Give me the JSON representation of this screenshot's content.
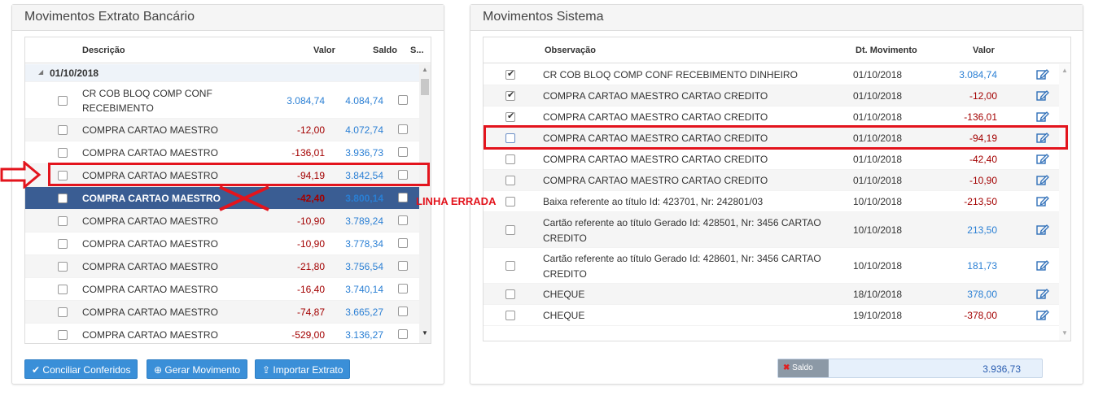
{
  "left_panel": {
    "title": "Movimentos Extrato Bancário",
    "columns": {
      "descricao": "Descrição",
      "valor": "Valor",
      "saldo": "Saldo",
      "s": "S..."
    },
    "group_label": "01/10/2018",
    "rows": [
      {
        "desc1": "CR COB BLOQ COMP CONF",
        "desc2": "RECEBIMENTO",
        "valor": "3.084,74",
        "saldo": "4.084,74"
      },
      {
        "desc1": "COMPRA CARTAO MAESTRO",
        "valor": "-12,00",
        "saldo": "4.072,74"
      },
      {
        "desc1": "COMPRA CARTAO MAESTRO",
        "valor": "-136,01",
        "saldo": "3.936,73"
      },
      {
        "desc1": "COMPRA CARTAO MAESTRO",
        "valor": "-94,19",
        "saldo": "3.842,54"
      },
      {
        "desc1": "COMPRA CARTAO MAESTRO",
        "valor": "-42,40",
        "saldo": "3.800,14"
      },
      {
        "desc1": "COMPRA CARTAO MAESTRO",
        "valor": "-10,90",
        "saldo": "3.789,24"
      },
      {
        "desc1": "COMPRA CARTAO MAESTRO",
        "valor": "-10,90",
        "saldo": "3.778,34"
      },
      {
        "desc1": "COMPRA CARTAO MAESTRO",
        "valor": "-21,80",
        "saldo": "3.756,54"
      },
      {
        "desc1": "COMPRA CARTAO MAESTRO",
        "valor": "-16,40",
        "saldo": "3.740,14"
      },
      {
        "desc1": "COMPRA CARTAO MAESTRO",
        "valor": "-74,87",
        "saldo": "3.665,27"
      },
      {
        "desc1": "COMPRA CARTAO MAESTRO",
        "valor": "-529,00",
        "saldo": "3.136,27"
      }
    ],
    "buttons": {
      "conciliar": "Conciliar Conferidos",
      "gerar": "Gerar Movimento",
      "importar": "Importar Extrato"
    }
  },
  "annotation": {
    "wrong_line": "LINHA ERRADA",
    "color": "#e3141d"
  },
  "right_panel": {
    "title": "Movimentos Sistema",
    "columns": {
      "observacao": "Observação",
      "dt_movimento": "Dt. Movimento",
      "valor": "Valor"
    },
    "rows": [
      {
        "obs1": "CR COB BLOQ COMP CONF RECEBIMENTO DINHEIRO",
        "dt": "01/10/2018",
        "valor": "3.084,74"
      },
      {
        "obs1": "COMPRA CARTAO MAESTRO CARTAO CREDITO",
        "dt": "01/10/2018",
        "valor": "-12,00"
      },
      {
        "obs1": "COMPRA CARTAO MAESTRO CARTAO CREDITO",
        "dt": "01/10/2018",
        "valor": "-136,01"
      },
      {
        "obs1": "COMPRA CARTAO MAESTRO CARTAO CREDITO",
        "dt": "01/10/2018",
        "valor": "-94,19"
      },
      {
        "obs1": "COMPRA CARTAO MAESTRO CARTAO CREDITO",
        "dt": "01/10/2018",
        "valor": "-42,40"
      },
      {
        "obs1": "COMPRA CARTAO MAESTRO CARTAO CREDITO",
        "dt": "01/10/2018",
        "valor": "-10,90"
      },
      {
        "obs1": "Baixa referente ao título Id: 423701, Nr: 242801/03",
        "dt": "10/10/2018",
        "valor": "-213,50"
      },
      {
        "obs1": "Cartão referente ao título Gerado Id: 428501, Nr: 3456 CARTAO",
        "obs2": "CREDITO",
        "dt": "10/10/2018",
        "valor": "213,50"
      },
      {
        "obs1": "Cartão referente ao título Gerado Id: 428601, Nr: 3456 CARTAO",
        "obs2": "CREDITO",
        "dt": "10/10/2018",
        "valor": "181,73"
      },
      {
        "obs1": "CHEQUE",
        "dt": "18/10/2018",
        "valor": "378,00"
      },
      {
        "obs1": "CHEQUE",
        "dt": "19/10/2018",
        "valor": "-378,00"
      }
    ],
    "saldo_label": "Saldo",
    "saldo_value": "3.936,73"
  }
}
